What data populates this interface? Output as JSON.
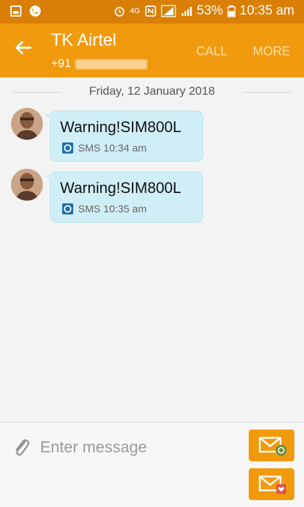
{
  "statusbar": {
    "network_label": "4G",
    "battery": "53%",
    "time": "10:35 am"
  },
  "conversation": {
    "title": "TK Airtel",
    "number_prefix": "+91",
    "actions": {
      "call": "CALL",
      "more": "MORE"
    }
  },
  "date_separator": "Friday, 12 January 2018",
  "messages": [
    {
      "text": "Warning!SIM800L",
      "meta": "SMS 10:34 am"
    },
    {
      "text": "Warning!SIM800L",
      "meta": "SMS 10:35 am"
    }
  ],
  "compose": {
    "placeholder": "Enter message"
  },
  "colors": {
    "status_bar": "#d97f06",
    "app_bar": "#f29a0e",
    "bubble": "#cfeef6",
    "accent": "#f29a0e"
  }
}
